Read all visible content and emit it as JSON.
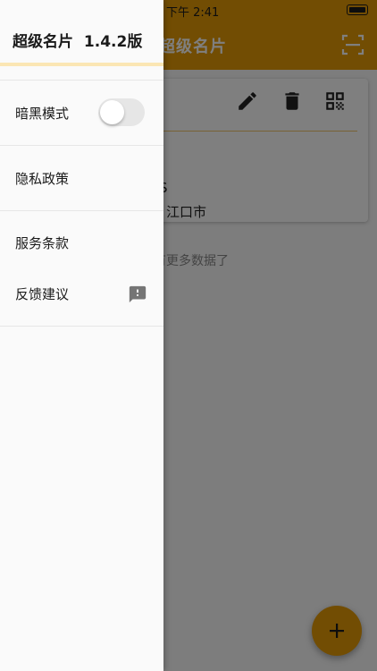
{
  "status_bar": {
    "time": "下午 2:41"
  },
  "app_bar": {
    "title": "超级名片"
  },
  "card": {
    "lines": [
      "S",
      "江口市"
    ]
  },
  "empty_hint": "有更多数据了",
  "drawer": {
    "title": "超级名片",
    "version": "1.4.2版",
    "items": [
      {
        "label": "暗黑模式",
        "control": "toggle",
        "toggle_on": false
      },
      {
        "label": "隐私政策"
      },
      {
        "label": "服务条款"
      },
      {
        "label": "反馈建议",
        "icon": "feedback-icon"
      }
    ]
  },
  "icons": {
    "scan": "scan-icon",
    "edit": "edit-icon",
    "delete": "delete-icon",
    "qr": "qr-code-icon",
    "add": "add-icon"
  },
  "colors": {
    "primary": "#e49a07",
    "drawer_bg": "#fafafa",
    "accent_strip": "#fbe6b4",
    "divider": "#e6e6e6"
  }
}
